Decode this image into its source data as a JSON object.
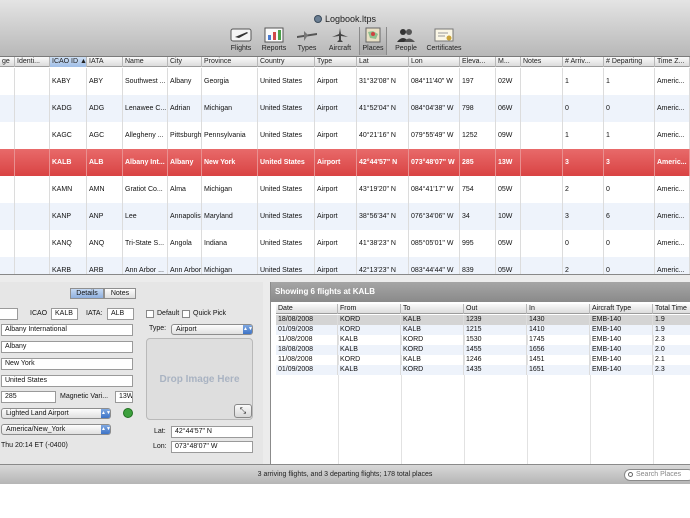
{
  "window": {
    "title": "Logbook.ltps"
  },
  "toolbar": [
    {
      "id": "flights",
      "label": "Flights",
      "icon": "airplane-icon"
    },
    {
      "id": "reports",
      "label": "Reports",
      "icon": "chart-icon"
    },
    {
      "id": "types",
      "label": "Types",
      "icon": "aircraft-types-icon"
    },
    {
      "id": "aircraft",
      "label": "Aircraft",
      "icon": "jet-icon"
    },
    {
      "id": "places",
      "label": "Places",
      "icon": "map-icon",
      "selected": true
    },
    {
      "id": "people",
      "label": "People",
      "icon": "people-icon"
    },
    {
      "id": "certificates",
      "label": "Certificates",
      "icon": "certificate-icon"
    }
  ],
  "places_table": {
    "columns": [
      "ge",
      "Identi...",
      "ICAO ID",
      "IATA",
      "Name",
      "City",
      "Province",
      "Country",
      "Type",
      "Lat",
      "Lon",
      "Eleva...",
      "M...",
      "Notes",
      "# Arriv...",
      "# Departing",
      "Time Z..."
    ],
    "sort_indicator": "▲",
    "rows": [
      [
        "",
        "",
        "KABY",
        "ABY",
        "Southwest ...",
        "Albany",
        "Georgia",
        "United States",
        "Airport",
        "31°32'08\" N",
        "084°11'40\" W",
        "197",
        "02W",
        "",
        "1",
        "1",
        "Americ..."
      ],
      [
        "",
        "",
        "KADG",
        "ADG",
        "Lenawee C...",
        "Adrian",
        "Michigan",
        "United States",
        "Airport",
        "41°52'04\" N",
        "084°04'38\" W",
        "798",
        "06W",
        "",
        "0",
        "0",
        "Americ..."
      ],
      [
        "",
        "",
        "KAGC",
        "AGC",
        "Allegheny ...",
        "Pittsburgh",
        "Pennsylvania",
        "United States",
        "Airport",
        "40°21'16\" N",
        "079°55'49\" W",
        "1252",
        "09W",
        "",
        "1",
        "1",
        "Americ..."
      ],
      [
        "",
        "",
        "KALB",
        "ALB",
        "Albany Int...",
        "Albany",
        "New York",
        "United States",
        "Airport",
        "42°44'57\" N",
        "073°48'07\" W",
        "285",
        "13W",
        "",
        "3",
        "3",
        "Americ..."
      ],
      [
        "",
        "",
        "KAMN",
        "AMN",
        "Gratiot Co...",
        "Alma",
        "Michigan",
        "United States",
        "Airport",
        "43°19'20\" N",
        "084°41'17\" W",
        "754",
        "05W",
        "",
        "2",
        "0",
        "Americ..."
      ],
      [
        "",
        "",
        "KANP",
        "ANP",
        "Lee",
        "Annapolis",
        "Maryland",
        "United States",
        "Airport",
        "38°56'34\" N",
        "076°34'06\" W",
        "34",
        "10W",
        "",
        "3",
        "6",
        "Americ..."
      ],
      [
        "",
        "",
        "KANQ",
        "ANQ",
        "Tri-State S...",
        "Angola",
        "Indiana",
        "United States",
        "Airport",
        "41°38'23\" N",
        "085°05'01\" W",
        "995",
        "05W",
        "",
        "0",
        "0",
        "Americ..."
      ],
      [
        "",
        "",
        "KARB",
        "ARB",
        "Ann Arbor ...",
        "Ann Arbor",
        "Michigan",
        "United States",
        "Airport",
        "42°13'23\" N",
        "083°44'44\" W",
        "839",
        "05W",
        "",
        "2",
        "0",
        "Americ..."
      ]
    ],
    "selected_row": 3
  },
  "inspector": {
    "tabs": [
      "Details",
      "Notes"
    ],
    "active_tab": "Details",
    "icao_label": "ICAO",
    "icao_value": "KALB",
    "iata_label": "IATA:",
    "iata_value": "ALB",
    "default_label": "Default",
    "quick_pick_label": "Quick Pick",
    "name_value": "Albany International",
    "city_value": "Albany",
    "province_value": "New York",
    "country_value": "United States",
    "type_label": "Type:",
    "type_value": "Airport",
    "elevation_value": "285",
    "magvar_label": "Magnetic Vari...",
    "magvar_value": "13W",
    "category_value": "Lighted Land Airport",
    "timezone_value": "America/New_York",
    "local_time": "Thu 20:14 ET (-0400)",
    "drop_image_text": "Drop Image Here",
    "lat_label": "Lat:",
    "lat_value": "42°44'57\" N",
    "lon_label": "Lon:",
    "lon_value": "073°48'07\" W"
  },
  "flights_panel": {
    "title": "Showing 6 flights at KALB",
    "columns": [
      "Date",
      "From",
      "To",
      "Out",
      "In",
      "Aircraft Type",
      "Total Time"
    ],
    "rows": [
      [
        "18/08/2008",
        "KORD",
        "KALB",
        "1239",
        "1430",
        "EMB-140",
        "1.9"
      ],
      [
        "01/09/2008",
        "KORD",
        "KALB",
        "1215",
        "1410",
        "EMB-140",
        "1.9"
      ],
      [
        "11/08/2008",
        "KALB",
        "KORD",
        "1530",
        "1745",
        "EMB-140",
        "2.3"
      ],
      [
        "18/08/2008",
        "KALB",
        "KORD",
        "1455",
        "1656",
        "EMB-140",
        "2.0"
      ],
      [
        "11/08/2008",
        "KORD",
        "KALB",
        "1246",
        "1451",
        "EMB-140",
        "2.1"
      ],
      [
        "01/09/2008",
        "KALB",
        "KORD",
        "1435",
        "1651",
        "EMB-140",
        "2.3"
      ]
    ],
    "selected_row": 0
  },
  "status_bar": {
    "text": "3 arriving flights, and 3 departing flights; 178 total places",
    "search_placeholder": "Search Places"
  },
  "colors": {
    "selection_red": "#d94343",
    "row_alt": "#eef3fb",
    "accent_blue": "#3d73c7"
  }
}
